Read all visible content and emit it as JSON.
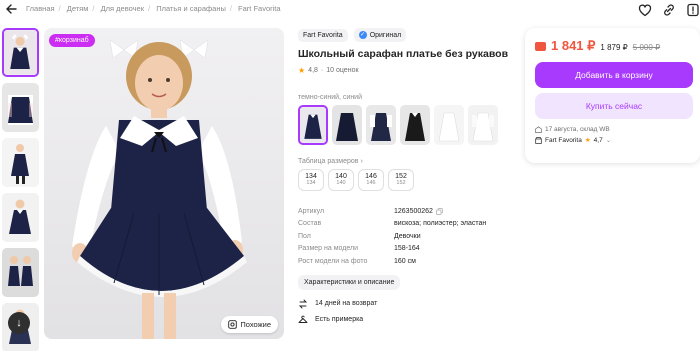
{
  "breadcrumbs": [
    "Главная",
    "Детям",
    "Для девочек",
    "Платья и сарафаны",
    "Fart Favorita"
  ],
  "badge": "#корзинаб",
  "similar_label": "Похожие",
  "brand": "Fart Favorita",
  "original_label": "Оригинал",
  "title": "Школьный сарафан платье без рукавов",
  "rating": {
    "value": "4,8",
    "count": "10 оценок"
  },
  "color_label": "темно-синий, синий",
  "sizes_label": "Таблица размеров",
  "sizes": [
    {
      "top": "134",
      "bottom": "134"
    },
    {
      "top": "140",
      "bottom": "140"
    },
    {
      "top": "146",
      "bottom": "146"
    },
    {
      "top": "152",
      "bottom": "152"
    }
  ],
  "props": [
    {
      "k": "Артикул",
      "v": "1263500262"
    },
    {
      "k": "Состав",
      "v": "вискоза; полиэстер; эластан"
    },
    {
      "k": "Пол",
      "v": "Девочки"
    },
    {
      "k": "Размер на модели",
      "v": "158-164"
    },
    {
      "k": "Рост модели на фото",
      "v": "160 см"
    }
  ],
  "characteristics_btn": "Характеристики и описание",
  "returns": "14 дней на возврат",
  "fitting": "Есть примерка",
  "price": {
    "main": "1 841 ₽",
    "alt": "1 879 ₽",
    "old": "5 000 ₽"
  },
  "add_to_cart": "Добавить в корзину",
  "buy_now": "Купить сейчас",
  "delivery": "17 августа, склад WB",
  "seller": {
    "name": "Fart Favorita",
    "rating": "4,7"
  },
  "colors": {
    "accent": "#a73afd",
    "price": "#f0563f",
    "dress": "#1d2346"
  }
}
